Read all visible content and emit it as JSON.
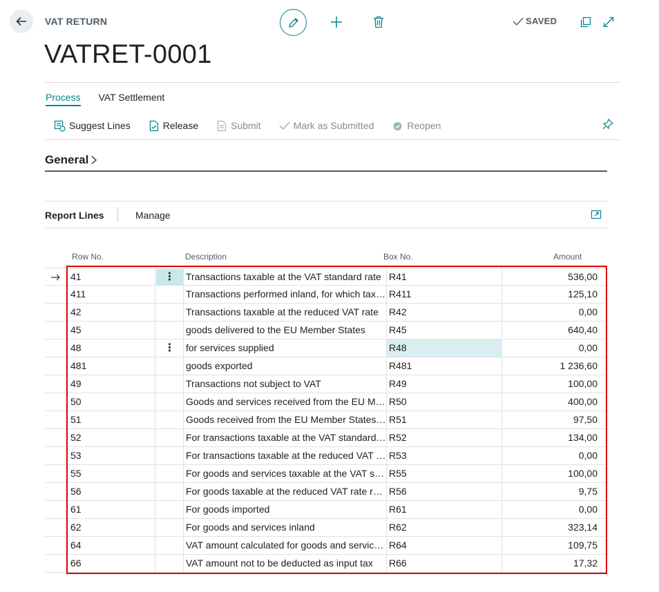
{
  "header": {
    "caption": "VAT RETURN",
    "title": "VATRET-0001",
    "saved_label": "SAVED"
  },
  "menu": {
    "tabs": [
      {
        "label": "Process"
      },
      {
        "label": "VAT Settlement"
      }
    ]
  },
  "actions": {
    "suggest_lines": "Suggest Lines",
    "release": "Release",
    "submit": "Submit",
    "mark_as_submitted": "Mark as Submitted",
    "reopen": "Reopen"
  },
  "general": {
    "title": "General"
  },
  "report_lines": {
    "title": "Report Lines",
    "manage": "Manage",
    "columns": {
      "row_no": "Row No.",
      "description": "Description",
      "box_no": "Box No.",
      "amount": "Amount"
    },
    "rows": [
      {
        "row_no": "41",
        "description": "Transactions taxable at the VAT standard rate",
        "box_no": "R41",
        "amount": "536,00"
      },
      {
        "row_no": "411",
        "description": "Transactions performed inland, for which tax is due",
        "box_no": "R411",
        "amount": "125,10"
      },
      {
        "row_no": "42",
        "description": "Transactions taxable at the reduced VAT rate",
        "box_no": "R42",
        "amount": "0,00"
      },
      {
        "row_no": "45",
        "description": "goods delivered to the EU Member States",
        "box_no": "R45",
        "amount": "640,40"
      },
      {
        "row_no": "48",
        "description": "for services supplied",
        "box_no": "R48",
        "amount": "0,00"
      },
      {
        "row_no": "481",
        "description": "goods exported",
        "box_no": "R481",
        "amount": "1 236,60"
      },
      {
        "row_no": "49",
        "description": "Transactions not subject to VAT",
        "box_no": "R49",
        "amount": "100,00"
      },
      {
        "row_no": "50",
        "description": "Goods and services received from the EU Member States",
        "box_no": "R50",
        "amount": "400,00"
      },
      {
        "row_no": "51",
        "description": "Goods received from the EU Member States (intra-community)",
        "box_no": "R51",
        "amount": "97,50"
      },
      {
        "row_no": "52",
        "description": "For transactions taxable at the VAT standard rate",
        "box_no": "R52",
        "amount": "134,00"
      },
      {
        "row_no": "53",
        "description": "For transactions taxable at the reduced VAT rate",
        "box_no": "R53",
        "amount": "0,00"
      },
      {
        "row_no": "55",
        "description": "For goods and services taxable at the VAT standard rate",
        "box_no": "R55",
        "amount": "100,00"
      },
      {
        "row_no": "56",
        "description": "For goods taxable at the reduced VAT rate received",
        "box_no": "R56",
        "amount": "9,75"
      },
      {
        "row_no": "61",
        "description": "For goods imported",
        "box_no": "R61",
        "amount": "0,00"
      },
      {
        "row_no": "62",
        "description": "For goods and services inland",
        "box_no": "R62",
        "amount": "323,14"
      },
      {
        "row_no": "64",
        "description": "VAT amount calculated for goods and services received",
        "box_no": "R64",
        "amount": "109,75"
      },
      {
        "row_no": "66",
        "description": "VAT amount not to be deducted as input tax",
        "box_no": "R66",
        "amount": "17,32"
      }
    ]
  },
  "colors": {
    "accent": "#00838f",
    "selection_highlight": "#d8eef0",
    "annotation_border": "#e00000"
  },
  "icons": [
    "back-arrow-icon",
    "pencil-icon",
    "plus-icon",
    "trash-icon",
    "checkmark-icon",
    "open-new-window-icon",
    "expand-icon",
    "suggest-lines-icon",
    "release-icon",
    "submit-icon",
    "mark-submitted-check-icon",
    "reopen-icon",
    "pin-icon",
    "chevron-right-icon",
    "part-expand-icon",
    "row-arrow-icon",
    "kebab-menu-icon"
  ]
}
